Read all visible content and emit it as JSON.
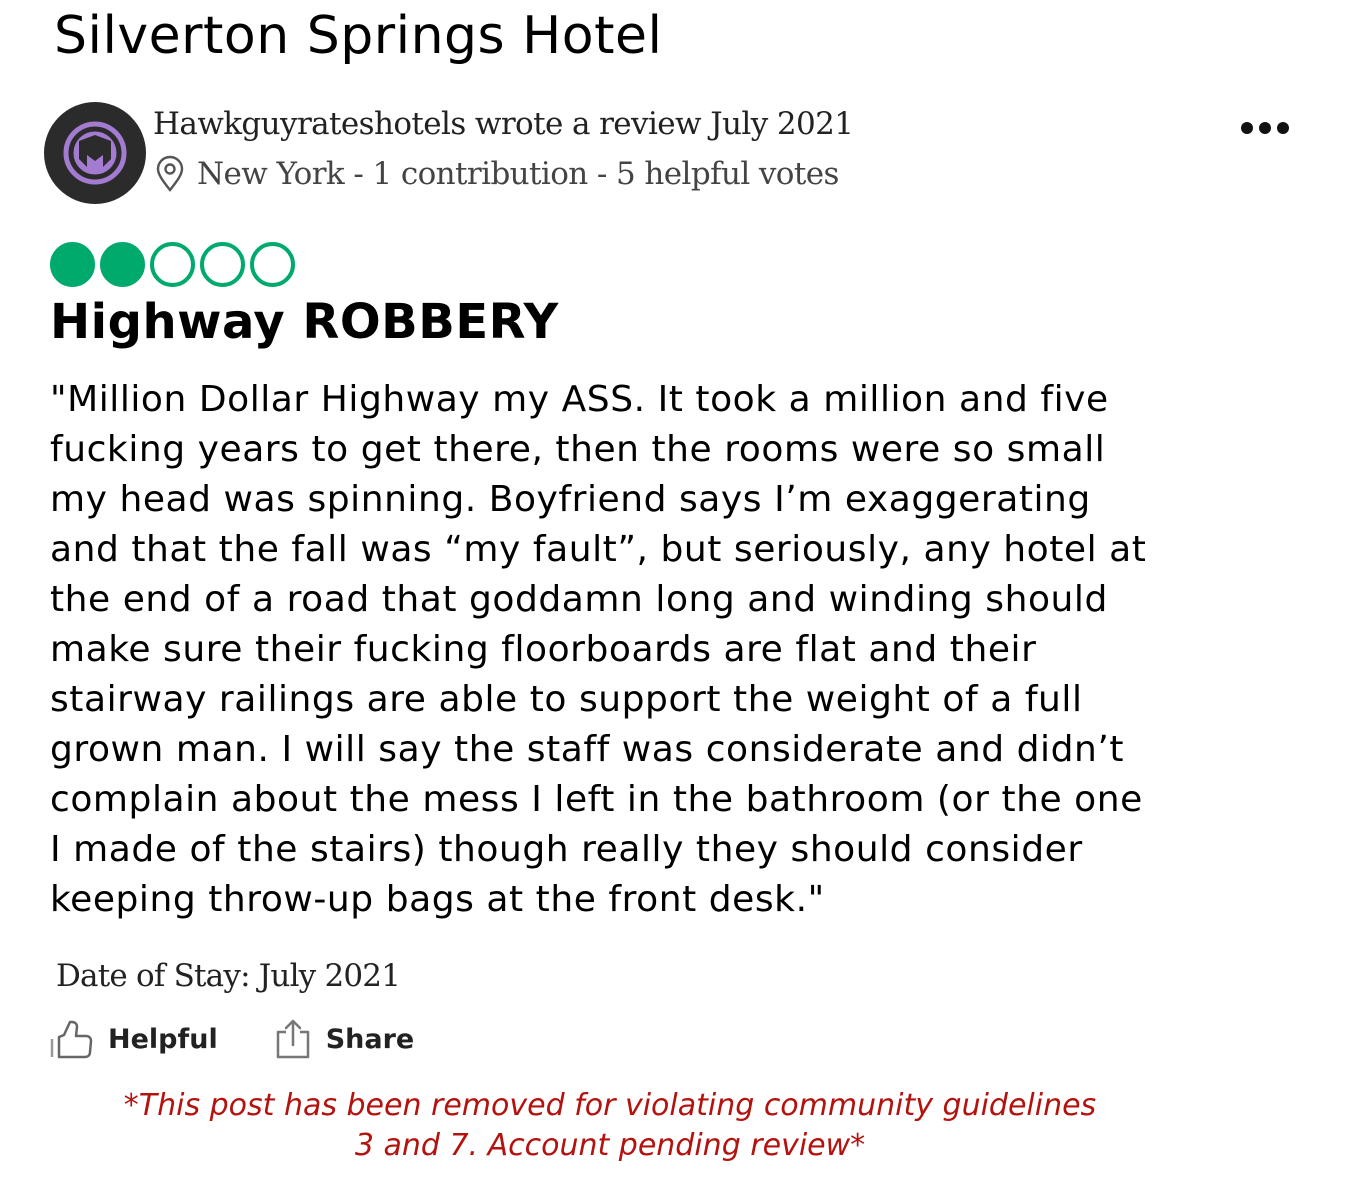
{
  "hotel": {
    "name": "Silverton Springs Hotel"
  },
  "reviewer": {
    "byline": "Hawkguyrateshotels wrote a review July 2021",
    "meta": "New York - 1 contribution - 5 helpful votes",
    "avatar_icon": "purple-shield-logo",
    "pin_icon": "location-pin-icon"
  },
  "menu": {
    "icon": "more-options-icon"
  },
  "review": {
    "rating": 2,
    "rating_max": 5,
    "rating_color": "#00aa6c",
    "title": "Highway ROBBERY",
    "body_lines": [
      "\"Million Dollar Highway my ASS. It took a million and five",
      "fucking years to get there, then the rooms were so small",
      "my head was spinning. Boyfriend says I’m exaggerating",
      "and that the fall was “my fault”, but seriously, any hotel at",
      "the end of a road that goddamn long and winding should",
      "make sure their fucking floorboards are flat and their",
      "stairway railings are able to support the weight of a full",
      "grown man. I will say the staff was considerate and didn’t",
      "complain about the mess I left in the bathroom (or the one",
      "I made of the stairs) though really they should consider",
      "keeping throw-up bags at the front desk.\""
    ],
    "date_of_stay": "Date of Stay: July 2021"
  },
  "actions": {
    "helpful_label": "Helpful",
    "share_label": "Share",
    "helpful_icon": "thumbs-up-icon",
    "share_icon": "share-icon"
  },
  "notice": {
    "line1": "*This post has been removed for violating community guidelines",
    "line2": "3 and 7. Account pending review*",
    "color": "#b3120e"
  }
}
